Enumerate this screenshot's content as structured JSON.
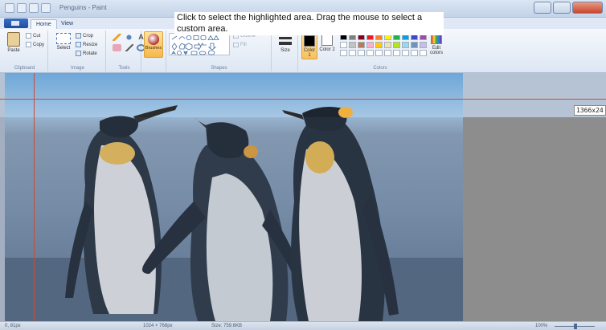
{
  "titlebar": {
    "title": "Penguins - Paint"
  },
  "ribbon": {
    "tabs": [
      "Home",
      "View"
    ],
    "clipboard": {
      "paste": "Paste",
      "cut": "Cut",
      "copy": "Copy",
      "label": "Clipboard"
    },
    "image": {
      "select": "Select",
      "crop": "Crop",
      "resize": "Resize",
      "rotate": "Rotate",
      "label": "Image"
    },
    "tools": {
      "label": "Tools"
    },
    "brushes": {
      "label": "Brushes"
    },
    "shapes": {
      "outline": "Outline",
      "fill": "Fill",
      "label": "Shapes"
    },
    "size": {
      "label": "Size"
    },
    "colors": {
      "color1": "Color 1",
      "color2": "Color 2",
      "edit": "Edit colors",
      "label": "Colors",
      "color1_value": "#000000",
      "color2_value": "#ffffff",
      "palette": [
        "#000000",
        "#7f7f7f",
        "#880015",
        "#ed1c24",
        "#ff7f27",
        "#fff200",
        "#22b14c",
        "#00a2e8",
        "#3f48cc",
        "#a349a4",
        "#ffffff",
        "#c3c3c3",
        "#b97a57",
        "#ffaec9",
        "#ffc90e",
        "#efe4b0",
        "#b5e61d",
        "#99d9ea",
        "#7092be",
        "#c8bfe7",
        "#ffffff",
        "#ffffff",
        "#ffffff",
        "#ffffff",
        "#ffffff",
        "#ffffff",
        "#ffffff",
        "#ffffff",
        "#ffffff",
        "#ffffff"
      ]
    }
  },
  "tooltip": {
    "text": "Click to select the highlighted area.  Drag the mouse to select a custom area."
  },
  "canvas": {
    "dimension_readout": "1366x24"
  },
  "statusbar": {
    "position": "0, 81px",
    "selection": "1024 × 768px",
    "size": "Size: 759.6KB",
    "zoom": "100%"
  }
}
